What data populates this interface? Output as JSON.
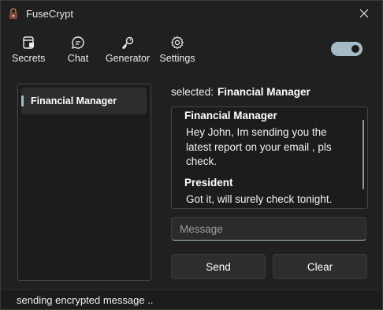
{
  "window": {
    "title": "FuseCrypt",
    "close_icon": "close-icon"
  },
  "toolbar": {
    "items": [
      {
        "label": "Secrets",
        "icon": "notebook-icon"
      },
      {
        "label": "Chat",
        "icon": "chat-bubble-icon"
      },
      {
        "label": "Generator",
        "icon": "key-icon"
      },
      {
        "label": "Settings",
        "icon": "gear-icon"
      }
    ],
    "toggle_on": true
  },
  "contacts": {
    "items": [
      {
        "label": "Financial Manager",
        "selected": true
      }
    ]
  },
  "conversation": {
    "selected_prefix": "selected:",
    "selected_name": "Financial Manager",
    "messages": [
      {
        "sender": "Financial Manager",
        "text": "Hey John, Im sending you the latest report on  your email , pls check."
      },
      {
        "sender": "President",
        "text": "Got it, will surely check tonight."
      }
    ]
  },
  "composer": {
    "placeholder": "Message",
    "value": "",
    "send_label": "Send",
    "clear_label": "Clear"
  },
  "status": {
    "text": "sending encrypted message .."
  },
  "colors": {
    "accent": "#a6bac6",
    "background": "#202020",
    "panel": "#1c1c1c",
    "button": "#2d2d2d"
  }
}
